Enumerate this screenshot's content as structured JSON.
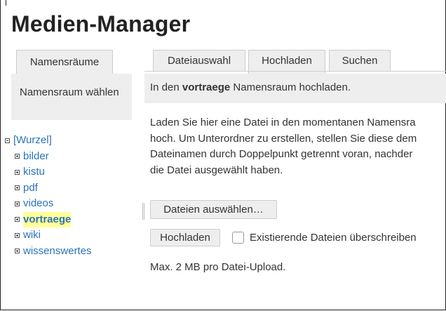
{
  "page": {
    "title": "Medien-Manager"
  },
  "namespaces": {
    "tab_label": "Namensräume",
    "panel_text": "Namensraum wählen",
    "tree": {
      "root": "[Wurzel]",
      "items": [
        "bilder",
        "kistu",
        "pdf",
        "videos",
        "vortraege",
        "wiki",
        "wissenswertes"
      ],
      "current": "vortraege"
    }
  },
  "tabs": {
    "items": [
      "Dateiauswahl",
      "Hochladen",
      "Suchen"
    ],
    "active": "Hochladen"
  },
  "upload": {
    "note_prefix": "In den ",
    "note_namespace": "vortraege",
    "note_suffix": " Namensraum hochladen.",
    "description_lines": [
      "Laden Sie hier eine Datei in den momentanen Namensra",
      "hoch. Um Unterordner zu erstellen, stellen Sie diese dem",
      "Dateinamen durch Doppelpunkt getrennt voran, nachder",
      "die Datei ausgewählt haben."
    ],
    "choose_button": "Dateien auswählen…",
    "upload_button": "Hochladen",
    "overwrite_label": "Existierende Dateien überschreiben",
    "overwrite_checked": false,
    "limit_text": "Max. 2 MB pro Datei-Upload."
  },
  "colors": {
    "link": "#2b73b7",
    "highlight": "#ffff99",
    "panel": "#eeeeee"
  }
}
